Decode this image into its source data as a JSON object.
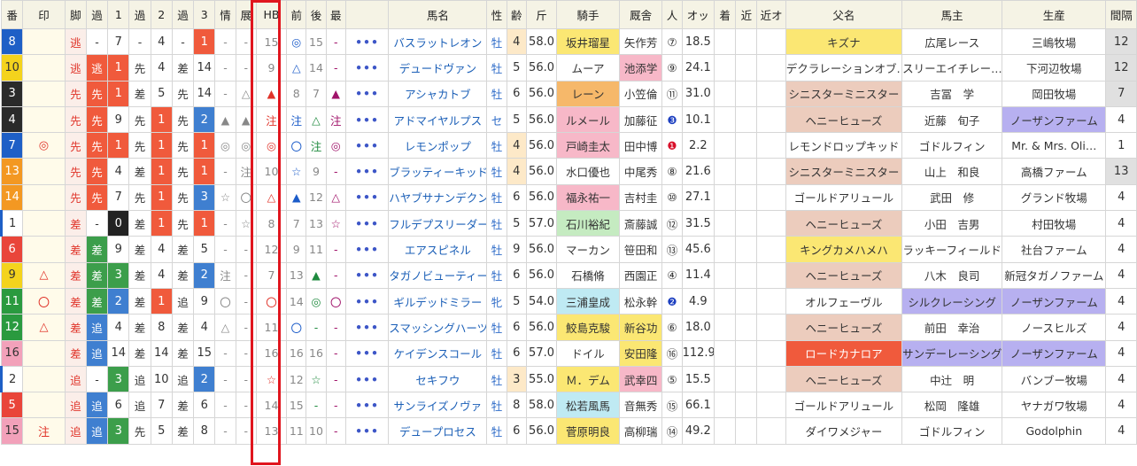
{
  "colors": {
    "waku": [
      "#ffffff",
      "#ffffff",
      "#2a2a2a",
      "#e9453a",
      "#1e5fc6",
      "#f4d31d",
      "#2a9a3f",
      "#f39822",
      "#f2a1ba"
    ],
    "style_red": "#f05a3c",
    "style_green": "#3c9e4b",
    "style_blue": "#3f7fd0",
    "jockey": {
      "pink": "#f7b8c8",
      "orange": "#f6b86a",
      "yellow": "#fbe773",
      "cyan": "#bfeaf3",
      "green": "#c5ebc1",
      "gray": "#ececec"
    },
    "stable": {
      "pink": "#f7b8c8",
      "yellow": "#fbe773"
    },
    "sire": {
      "yellow": "#fbe773",
      "red": "#f05a3c",
      "tan": "#ecccbd"
    },
    "owner": {
      "purple": "#b7b0f0"
    },
    "breeder": {
      "purple": "#b7b0f0"
    },
    "interval_gray": "#e0e0e0",
    "hb_frame": "#e0151e"
  },
  "headers": [
    "番",
    "印",
    "脚",
    "過",
    "1",
    "過",
    "2",
    "過",
    "3",
    "情",
    "展",
    "HB",
    "前",
    "後",
    "最",
    "",
    "馬名",
    "性",
    "齢",
    "斤",
    "騎手",
    "厩舎",
    "人",
    "オッ",
    "着",
    "近",
    "近オ",
    "父名",
    "馬主",
    "生産",
    "間隔"
  ],
  "rows": [
    {
      "num": "8",
      "mark": "",
      "style": "逃",
      "k1": "-",
      "p1": "7",
      "k2": "-",
      "p2": "4",
      "k3": "-",
      "p3": "1",
      "info": "-",
      "ten": "-",
      "hb": "15",
      "mae": "◎",
      "ato": "15",
      "sai": "-",
      "name": "バスラットレオン",
      "sex": "牡",
      "age": "4",
      "kin": "58.0",
      "jockey": "坂井瑠星",
      "stable": "矢作芳",
      "pop": "⑦",
      "odds": "18.5",
      "chaku": "",
      "kin2": "",
      "kino": "",
      "sire": "キズナ",
      "owner": "広尾レース",
      "breeder": "三嶋牧場",
      "interval": "12"
    },
    {
      "num": "10",
      "mark": "",
      "style": "逃",
      "k1": "逃",
      "p1": "1",
      "k2": "先",
      "p2": "4",
      "k3": "差",
      "p3": "14",
      "info": "-",
      "ten": "-",
      "hb": "9",
      "mae": "△",
      "ato": "14",
      "sai": "-",
      "name": "デュードヴァン",
      "sex": "牡",
      "age": "5",
      "kin": "56.0",
      "jockey": "ムーア",
      "stable": "池添学",
      "pop": "⑨",
      "odds": "24.1",
      "chaku": "",
      "kin2": "",
      "kino": "",
      "sire": "デクラレーションオブ…",
      "owner": "スリーエイチレー…",
      "breeder": "下河辺牧場",
      "interval": "12"
    },
    {
      "num": "3",
      "mark": "",
      "style": "先",
      "k1": "先",
      "p1": "1",
      "k2": "差",
      "p2": "5",
      "k3": "先",
      "p3": "14",
      "info": "-",
      "ten": "△",
      "hb": "▲",
      "mae": "8",
      "ato": "7",
      "sai": "▲",
      "name": "アシャカトブ",
      "sex": "牡",
      "age": "6",
      "kin": "56.0",
      "jockey": "レーン",
      "stable": "小笠倫",
      "pop": "⑪",
      "odds": "31.0",
      "chaku": "",
      "kin2": "",
      "kino": "",
      "sire": "シニスターミニスター",
      "owner": "吉冨　学",
      "breeder": "岡田牧場",
      "interval": "7"
    },
    {
      "num": "4",
      "mark": "",
      "style": "先",
      "k1": "先",
      "p1": "9",
      "k2": "先",
      "p2": "1",
      "k3": "先",
      "p3": "2",
      "info": "▲",
      "ten": "▲",
      "hb": "注",
      "mae": "注",
      "ato": "△",
      "sai": "注",
      "name": "アドマイヤルプス",
      "sex": "セ",
      "age": "5",
      "kin": "56.0",
      "jockey": "ルメール",
      "stable": "加藤征",
      "pop": "❸",
      "odds": "10.1",
      "chaku": "",
      "kin2": "",
      "kino": "",
      "sire": "ヘニーヒューズ",
      "owner": "近藤　旬子",
      "breeder": "ノーザンファーム",
      "interval": "4"
    },
    {
      "num": "7",
      "mark": "◎",
      "style": "先",
      "k1": "先",
      "p1": "1",
      "k2": "先",
      "p2": "1",
      "k3": "先",
      "p3": "1",
      "info": "◎",
      "ten": "◎",
      "hb": "◎",
      "mae": "〇",
      "ato": "注",
      "sai": "◎",
      "name": "レモンポップ",
      "sex": "牡",
      "age": "4",
      "kin": "56.0",
      "jockey": "戸崎圭太",
      "stable": "田中博",
      "pop": "❶",
      "odds": "2.2",
      "chaku": "",
      "kin2": "",
      "kino": "",
      "sire": "レモンドロップキッド",
      "owner": "ゴドルフィン",
      "breeder": "Mr. & Mrs. Oli…",
      "interval": "1"
    },
    {
      "num": "13",
      "mark": "",
      "style": "先",
      "k1": "先",
      "p1": "4",
      "k2": "差",
      "p2": "1",
      "k3": "先",
      "p3": "1",
      "info": "-",
      "ten": "注",
      "hb": "10",
      "mae": "☆",
      "ato": "9",
      "sai": "-",
      "name": "ブラッティーキッド",
      "sex": "牡",
      "age": "4",
      "kin": "56.0",
      "jockey": "水口優也",
      "stable": "中尾秀",
      "pop": "⑧",
      "odds": "21.6",
      "chaku": "",
      "kin2": "",
      "kino": "",
      "sire": "シニスターミニスター",
      "owner": "山上　和良",
      "breeder": "高橋ファーム",
      "interval": "13"
    },
    {
      "num": "14",
      "mark": "",
      "style": "先",
      "k1": "先",
      "p1": "7",
      "k2": "先",
      "p2": "1",
      "k3": "先",
      "p3": "3",
      "info": "☆",
      "ten": "〇",
      "hb": "△",
      "mae": "▲",
      "ato": "12",
      "sai": "△",
      "name": "ハヤブサナンデクン",
      "sex": "牡",
      "age": "6",
      "kin": "56.0",
      "jockey": "福永祐一",
      "stable": "吉村圭",
      "pop": "⑩",
      "odds": "27.1",
      "chaku": "",
      "kin2": "",
      "kino": "",
      "sire": "ゴールドアリュール",
      "owner": "武田　修",
      "breeder": "グランド牧場",
      "interval": "4"
    },
    {
      "num": "1",
      "mark": "",
      "style": "差",
      "k1": "-",
      "p1": "0",
      "k2": "差",
      "p2": "1",
      "k3": "先",
      "p3": "1",
      "info": "-",
      "ten": "☆",
      "hb": "8",
      "mae": "7",
      "ato": "13",
      "sai": "☆",
      "name": "フルデプスリーダー",
      "sex": "牡",
      "age": "5",
      "kin": "57.0",
      "jockey": "石川裕紀",
      "stable": "斎藤誠",
      "pop": "⑫",
      "odds": "31.5",
      "chaku": "",
      "kin2": "",
      "kino": "",
      "sire": "ヘニーヒューズ",
      "owner": "小田　吉男",
      "breeder": "村田牧場",
      "interval": "4"
    },
    {
      "num": "6",
      "mark": "",
      "style": "差",
      "k1": "差",
      "p1": "9",
      "k2": "差",
      "p2": "4",
      "k3": "差",
      "p3": "5",
      "info": "-",
      "ten": "-",
      "hb": "12",
      "mae": "9",
      "ato": "11",
      "sai": "-",
      "name": "エアスピネル",
      "sex": "牡",
      "age": "9",
      "kin": "56.0",
      "jockey": "マーカン",
      "stable": "笹田和",
      "pop": "⑬",
      "odds": "45.6",
      "chaku": "",
      "kin2": "",
      "kino": "",
      "sire": "キングカメハメハ",
      "owner": "ラッキーフィールド",
      "breeder": "社台ファーム",
      "interval": "4"
    },
    {
      "num": "9",
      "mark": "△",
      "style": "差",
      "k1": "差",
      "p1": "3",
      "k2": "差",
      "p2": "4",
      "k3": "差",
      "p3": "2",
      "info": "注",
      "ten": "-",
      "hb": "7",
      "mae": "13",
      "ato": "▲",
      "sai": "-",
      "name": "タガノビューティー",
      "sex": "牡",
      "age": "6",
      "kin": "56.0",
      "jockey": "石橋脩",
      "stable": "西園正",
      "pop": "④",
      "odds": "11.4",
      "chaku": "",
      "kin2": "",
      "kino": "",
      "sire": "ヘニーヒューズ",
      "owner": "八木　良司",
      "breeder": "新冠タガノファーム",
      "interval": "4"
    },
    {
      "num": "11",
      "mark": "〇",
      "style": "差",
      "k1": "差",
      "p1": "2",
      "k2": "差",
      "p2": "1",
      "k3": "追",
      "p3": "9",
      "info": "〇",
      "ten": "-",
      "hb": "〇",
      "mae": "14",
      "ato": "◎",
      "sai": "〇",
      "name": "ギルデッドミラー",
      "sex": "牝",
      "age": "5",
      "kin": "54.0",
      "jockey": "三浦皇成",
      "stable": "松永幹",
      "pop": "❷",
      "odds": "4.9",
      "chaku": "",
      "kin2": "",
      "kino": "",
      "sire": "オルフェーヴル",
      "owner": "シルクレーシング",
      "breeder": "ノーザンファーム",
      "interval": "4"
    },
    {
      "num": "12",
      "mark": "△",
      "style": "差",
      "k1": "追",
      "p1": "4",
      "k2": "差",
      "p2": "8",
      "k3": "差",
      "p3": "4",
      "info": "△",
      "ten": "-",
      "hb": "11",
      "mae": "〇",
      "ato": "-",
      "sai": "-",
      "name": "スマッシングハーツ",
      "sex": "牡",
      "age": "6",
      "kin": "56.0",
      "jockey": "鮫島克駿",
      "stable": "新谷功",
      "pop": "⑥",
      "odds": "18.0",
      "chaku": "",
      "kin2": "",
      "kino": "",
      "sire": "ヘニーヒューズ",
      "owner": "前田　幸治",
      "breeder": "ノースヒルズ",
      "interval": "4"
    },
    {
      "num": "16",
      "mark": "",
      "style": "差",
      "k1": "追",
      "p1": "14",
      "k2": "差",
      "p2": "14",
      "k3": "差",
      "p3": "15",
      "info": "-",
      "ten": "-",
      "hb": "16",
      "mae": "16",
      "ato": "16",
      "sai": "-",
      "name": "ケイデンスコール",
      "sex": "牡",
      "age": "6",
      "kin": "57.0",
      "jockey": "ドイル",
      "stable": "安田隆",
      "pop": "⑯",
      "odds": "112.9",
      "chaku": "",
      "kin2": "",
      "kino": "",
      "sire": "ロードカナロア",
      "owner": "サンデーレーシング",
      "breeder": "ノーザンファーム",
      "interval": "4"
    },
    {
      "num": "2",
      "mark": "",
      "style": "追",
      "k1": "-",
      "p1": "3",
      "k2": "追",
      "p2": "10",
      "k3": "追",
      "p3": "2",
      "info": "-",
      "ten": "-",
      "hb": "☆",
      "mae": "12",
      "ato": "☆",
      "sai": "-",
      "name": "セキフウ",
      "sex": "牡",
      "age": "3",
      "kin": "55.0",
      "jockey": "Ｍ．デム",
      "stable": "武幸四",
      "pop": "⑤",
      "odds": "15.5",
      "chaku": "",
      "kin2": "",
      "kino": "",
      "sire": "ヘニーヒューズ",
      "owner": "中辻　明",
      "breeder": "バンブー牧場",
      "interval": "4"
    },
    {
      "num": "5",
      "mark": "",
      "style": "追",
      "k1": "追",
      "p1": "6",
      "k2": "追",
      "p2": "7",
      "k3": "差",
      "p3": "6",
      "info": "-",
      "ten": "-",
      "hb": "14",
      "mae": "15",
      "ato": "-",
      "sai": "-",
      "name": "サンライズノヴァ",
      "sex": "牡",
      "age": "8",
      "kin": "58.0",
      "jockey": "松若風馬",
      "stable": "音無秀",
      "pop": "⑮",
      "odds": "66.1",
      "chaku": "",
      "kin2": "",
      "kino": "",
      "sire": "ゴールドアリュール",
      "owner": "松岡　隆雄",
      "breeder": "ヤナガワ牧場",
      "interval": "4"
    },
    {
      "num": "15",
      "mark": "注",
      "style": "追",
      "k1": "追",
      "p1": "3",
      "k2": "先",
      "p2": "5",
      "k3": "差",
      "p3": "8",
      "info": "-",
      "ten": "-",
      "hb": "13",
      "mae": "11",
      "ato": "10",
      "sai": "-",
      "name": "デュープロセス",
      "sex": "牡",
      "age": "6",
      "kin": "56.0",
      "jockey": "菅原明良",
      "stable": "高柳瑞",
      "pop": "⑭",
      "odds": "49.2",
      "chaku": "",
      "kin2": "",
      "kino": "",
      "sire": "ダイワメジャー",
      "owner": "ゴドルフィン",
      "breeder": "Godolphin",
      "interval": "4"
    }
  ]
}
